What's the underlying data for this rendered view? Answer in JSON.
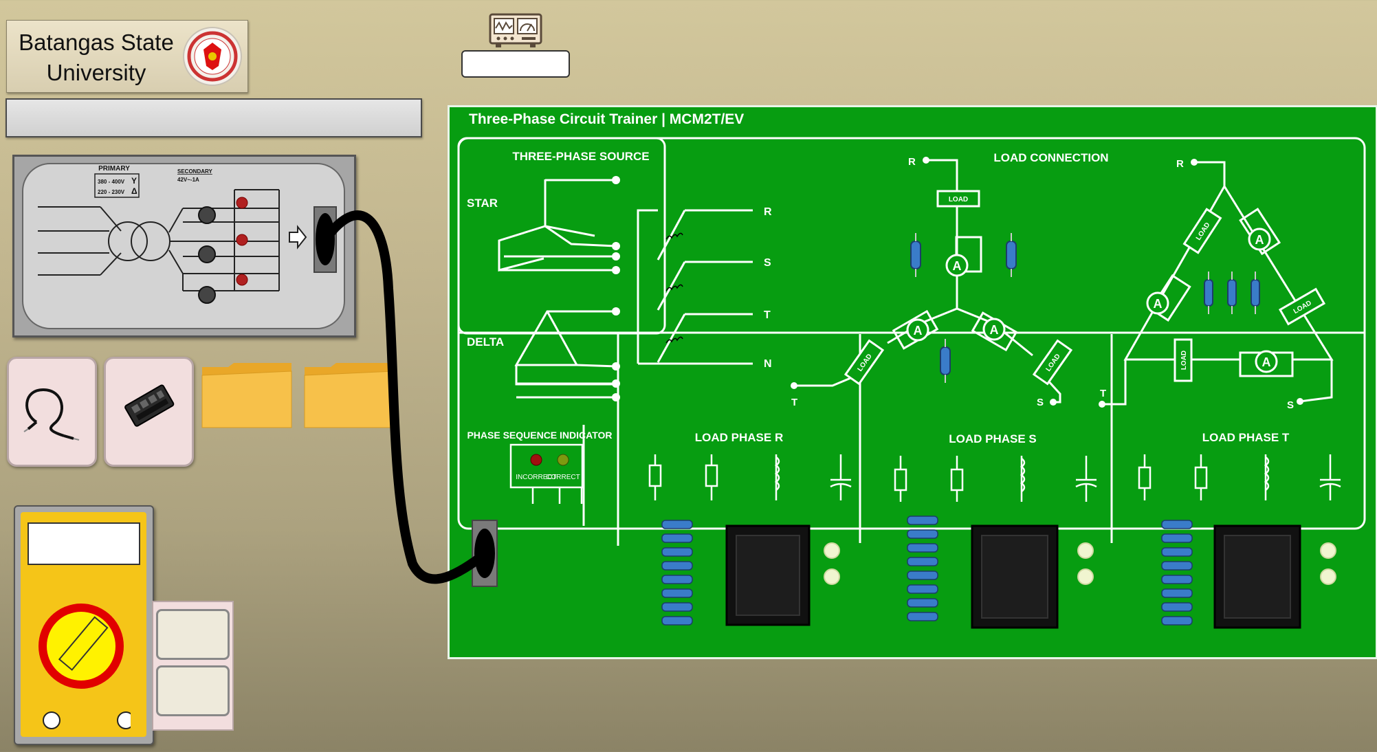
{
  "university": {
    "name": "Batangas State University"
  },
  "status": {
    "message": ""
  },
  "instrument": {
    "readout": ""
  },
  "trainer": {
    "title": "Three-Phase Circuit Trainer | MCM2T/EV",
    "source_title": "THREE-PHASE SOURCE",
    "star_label": "STAR",
    "delta_label": "DELTA",
    "source_terminals": [
      "R",
      "S",
      "T",
      "N"
    ],
    "load_connection_title": "LOAD CONNECTION",
    "load_label": "LOAD",
    "ammeter_symbol": "A",
    "terminals": {
      "r": "R",
      "s": "S",
      "t": "T"
    },
    "psi_title": "PHASE SEQUENCE INDICATOR",
    "psi_incorrect": "INCORRECT",
    "psi_correct": "CORRECT",
    "load_phase_r": "LOAD PHASE R",
    "load_phase_s": "LOAD PHASE S",
    "load_phase_t": "LOAD PHASE T"
  },
  "transformer": {
    "primary_label": "PRIMARY",
    "primary_v1": "380 - 400V",
    "primary_sym1": "Y",
    "primary_v2": "220 - 230V",
    "primary_sym2": "Δ",
    "secondary_label": "SECONDARY",
    "secondary_rating": "42V~-1A"
  },
  "multimeter": {
    "display": ""
  },
  "colors": {
    "panel_green": "#079d11",
    "multimeter_body": "#f5c518",
    "dial_ring": "#e10000",
    "folder": "#f2b83a",
    "cable": "#000000"
  },
  "icons": [
    "oscilloscope-icon",
    "cable-icon",
    "connector-icon",
    "folder-icon"
  ]
}
